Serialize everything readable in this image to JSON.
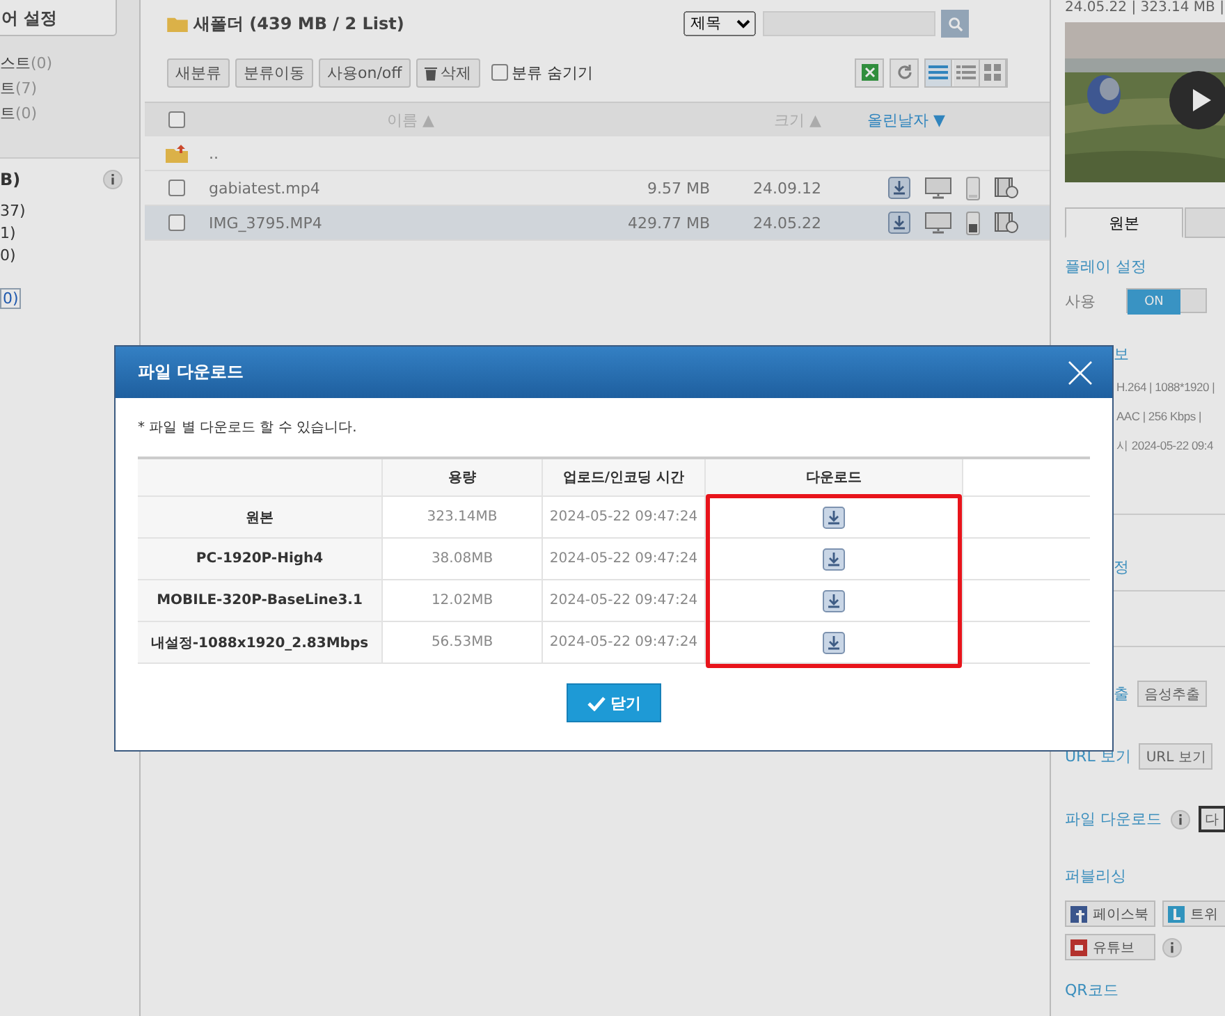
{
  "sidebar": {
    "settings_button": "어 설정",
    "lists": [
      {
        "label": "스트",
        "count": "(0)"
      },
      {
        "label": "트",
        "count": "(7)"
      },
      {
        "label": "트",
        "count": "(0)"
      }
    ],
    "storage_title": "B)",
    "storage_items": [
      "37)",
      "1)",
      "0)"
    ],
    "link": "0)"
  },
  "main": {
    "folder_title": "새폴더 (439 MB / 2 List)",
    "search": {
      "select": "제목"
    },
    "toolbar": [
      {
        "label": "새분류",
        "kind": "text"
      },
      {
        "label": "분류이동",
        "kind": "text"
      },
      {
        "label": "사용on/off",
        "kind": "text"
      },
      {
        "label": "삭제",
        "kind": "trash"
      }
    ],
    "hide_categories": {
      "label": "분류 숨기기",
      "checked": false
    },
    "views": [
      {
        "kind": "list",
        "selected": true
      },
      {
        "kind": "detail",
        "selected": false
      },
      {
        "kind": "grid",
        "selected": false
      }
    ],
    "columns": [
      {
        "label": "이름",
        "arrow": "▲",
        "selected": false
      },
      {
        "label": "크기",
        "arrow": "▲",
        "selected": false
      },
      {
        "label": "올린날자",
        "arrow": "▼",
        "selected": true
      }
    ],
    "select_all": {
      "checked": false
    },
    "parent_row": "..",
    "rows": [
      {
        "name": "gabiatest.mp4",
        "size": "9.57 MB",
        "date": "24.09.12",
        "selected": false,
        "mobile": false
      },
      {
        "name": "IMG_3795.MP4",
        "size": "429.77 MB",
        "date": "24.05.22",
        "selected": true,
        "mobile": true
      }
    ]
  },
  "right": {
    "meta": "24.05.22 | 323.14 MB |",
    "tabs": [
      {
        "label": "원본",
        "selected": true
      },
      {
        "selected": false
      }
    ],
    "play_settings": "플레이 설정",
    "use_label": "사용",
    "toggle": {
      "label": "ON",
      "on": true
    },
    "info_title": "보",
    "info_lines": [
      "H.264 | 1088*1920 |",
      "AAC | 256 Kbps |",
      "시 2024-05-22 09:4"
    ],
    "section_tail": "정",
    "actions": [
      {
        "label": "출",
        "button": "음성추출",
        "info": false
      },
      {
        "label": "URL 보기",
        "button": "URL 보기",
        "info": false
      },
      {
        "label": "파일 다운로드",
        "button": "다",
        "info": true
      }
    ],
    "publishing": "퍼블리싱",
    "social": [
      {
        "kind": "facebook",
        "label": "페이스북"
      },
      {
        "kind": "twitter",
        "label": "트위"
      },
      {
        "kind": "youtube",
        "label": "유튜브"
      }
    ],
    "qr": "QR코드"
  },
  "modal": {
    "title": "파일 다운로드",
    "note": "* 파일 별 다운로드 할 수 있습니다.",
    "columns": [
      "용량",
      "업로드/인코딩 시간",
      "다운로드"
    ],
    "rows": [
      {
        "name": "원본",
        "size": "323.14MB",
        "time": "2024-05-22 09:47:24"
      },
      {
        "name": "PC-1920P-High4",
        "size": "38.08MB",
        "time": "2024-05-22 09:47:24"
      },
      {
        "name": "MOBILE-320P-BaseLine3.1",
        "size": "12.02MB",
        "time": "2024-05-22 09:47:24"
      },
      {
        "name": "내설정-1088x1920_2.83Mbps",
        "size": "56.53MB",
        "time": "2024-05-22 09:47:24"
      }
    ],
    "download_highlighted": true,
    "close_button": "닫기"
  }
}
